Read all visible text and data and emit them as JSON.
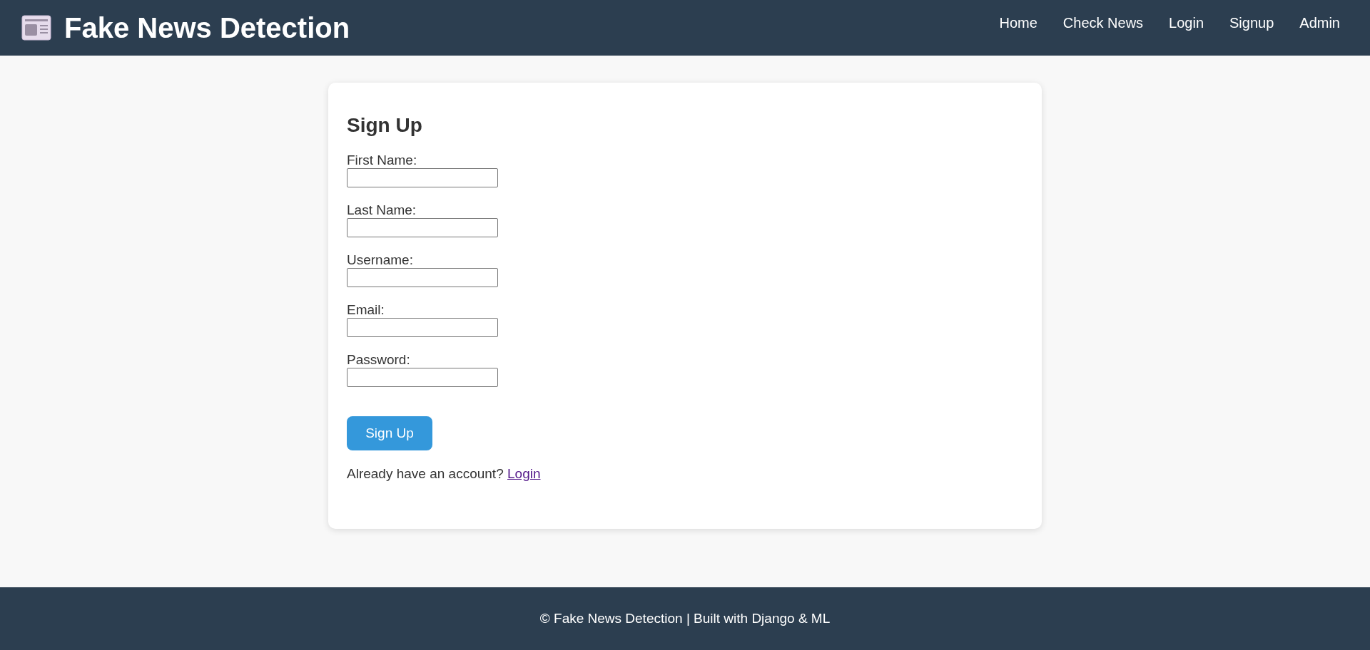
{
  "header": {
    "title": "Fake News Detection",
    "nav": [
      "Home",
      "Check News",
      "Login",
      "Signup",
      "Admin"
    ]
  },
  "form": {
    "heading": "Sign Up",
    "fields": [
      {
        "label": "First Name:"
      },
      {
        "label": "Last Name:"
      },
      {
        "label": "Username:"
      },
      {
        "label": "Email:"
      },
      {
        "label": "Password:"
      }
    ],
    "submit": "Sign Up",
    "footer_text": "Already have an account?",
    "footer_link": "Login"
  },
  "footer": {
    "text": "© Fake News Detection | Built with Django & ML"
  }
}
